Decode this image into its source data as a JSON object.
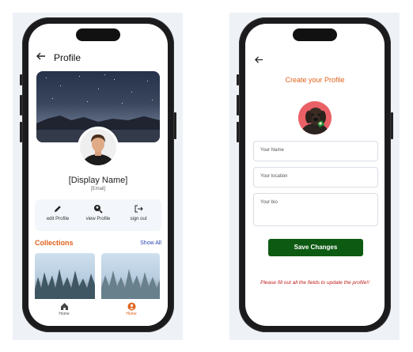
{
  "left_screen": {
    "header": {
      "title": "Profile",
      "back_icon": "back-arrow-icon"
    },
    "profile": {
      "display_name": "[Display Name]",
      "email": "[Email]"
    },
    "actions": [
      {
        "label": "edit Profile",
        "icon": "pencil-icon"
      },
      {
        "label": "view Profile",
        "icon": "magnifier-icon"
      },
      {
        "label": "sign out",
        "icon": "sign-out-icon"
      }
    ],
    "collections": {
      "title": "Collections",
      "show_all": "Show All"
    },
    "bottom_nav": [
      {
        "label": "Home",
        "icon": "home-icon"
      },
      {
        "label": "Home",
        "icon": "profile-icon"
      }
    ]
  },
  "right_screen": {
    "header": {
      "back_icon": "back-arrow-icon",
      "title": "Create your Profile"
    },
    "form": {
      "name_placeholder": "Your Name",
      "location_placeholder": "Your location",
      "bio_placeholder": "Your bio",
      "save_label": "Save Changes"
    },
    "warning_text": "Please fill out all the fields to update the profile!!"
  },
  "colors": {
    "accent_orange": "#e0621c",
    "link_blue": "#2d46b6",
    "save_green": "#0d5a12",
    "warning_red": "#c0201f"
  }
}
